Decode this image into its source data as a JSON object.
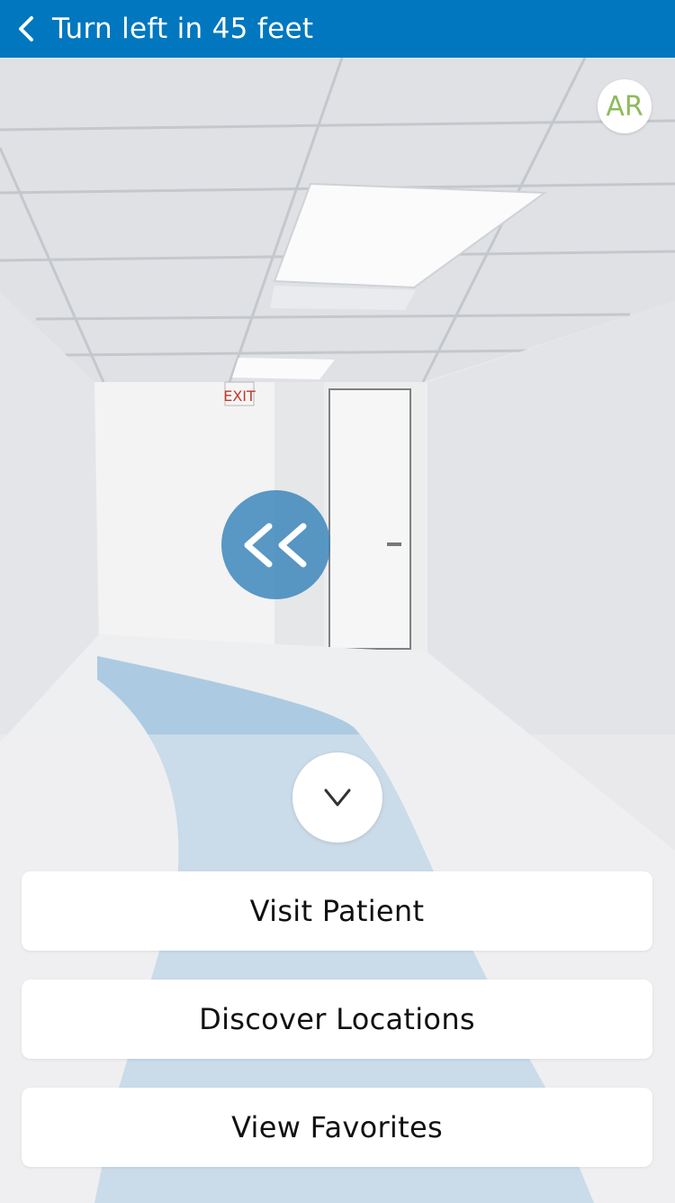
{
  "header": {
    "title": "Turn left in 45 feet",
    "back_icon": "chevron-left-icon"
  },
  "ar_toggle": {
    "label": "AR"
  },
  "turn_indicator": {
    "icon": "double-chevron-left-icon"
  },
  "collapse_button": {
    "icon": "chevron-down-icon"
  },
  "scene": {
    "sign_text": "EXIT"
  },
  "actions": [
    {
      "label": "Visit Patient"
    },
    {
      "label": "Discover Locations"
    },
    {
      "label": "View Favorites"
    }
  ],
  "colors": {
    "brand": "#0077be",
    "ar": "#8dbb5a",
    "path": "#6aa8d4",
    "indicator": "#3782b9"
  }
}
